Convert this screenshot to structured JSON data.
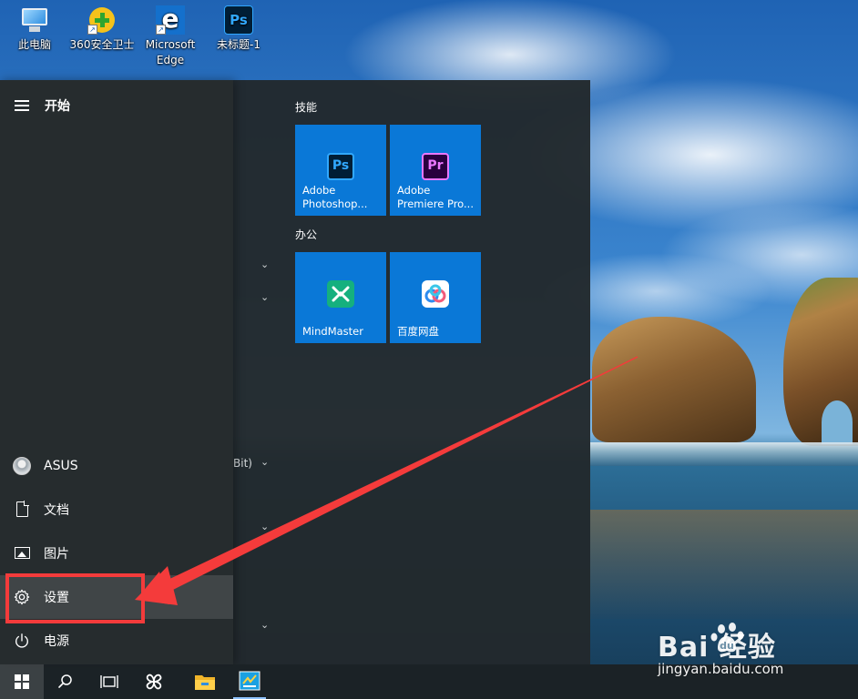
{
  "desktop": {
    "icons": [
      {
        "label": "此电脑",
        "icon": "computer-icon"
      },
      {
        "label": "360安全卫士",
        "icon": "360-security-icon"
      },
      {
        "label": "Microsoft Edge",
        "icon": "edge-icon"
      },
      {
        "label": "未标题-1",
        "icon": "photoshop-file-icon"
      }
    ],
    "ps_icon_text": "Ps",
    "edge_icon_text": "e",
    "shortcut_arrow": "↗"
  },
  "start_menu": {
    "title": "开始",
    "left_items": [
      {
        "label": "ASUS",
        "icon": "user-avatar-icon"
      },
      {
        "label": "文档",
        "icon": "document-icon"
      },
      {
        "label": "图片",
        "icon": "pictures-icon"
      },
      {
        "label": "设置",
        "icon": "gear-icon"
      },
      {
        "label": "电源",
        "icon": "power-icon"
      }
    ],
    "app_list_fragment": "Bit)",
    "expand_chevron": "⌄",
    "groups": [
      {
        "title": "技能",
        "tiles": [
          {
            "label_line1": "Adobe",
            "label_line2": "Photoshop...",
            "icon_text": "Ps",
            "icon": "photoshop-icon"
          },
          {
            "label_line1": "Adobe",
            "label_line2": "Premiere Pro...",
            "icon_text": "Pr",
            "icon": "premiere-icon"
          }
        ]
      },
      {
        "title": "办公",
        "tiles": [
          {
            "label_line1": "MindMaster",
            "icon": "mindmaster-icon"
          },
          {
            "label_line1": "百度网盘",
            "icon": "baidu-netdisk-icon"
          }
        ]
      }
    ]
  },
  "taskbar": {
    "items": [
      "start-button",
      "search",
      "task-view",
      "pinwheel-app",
      "file-explorer",
      "active-app"
    ]
  },
  "watermark": {
    "main": "Bai  经验",
    "sub": "jingyan.baidu.com"
  },
  "colors": {
    "tile_blue": "#0a78d7",
    "annotation_red": "#f43b3b",
    "menu_bg": "#22292c"
  }
}
